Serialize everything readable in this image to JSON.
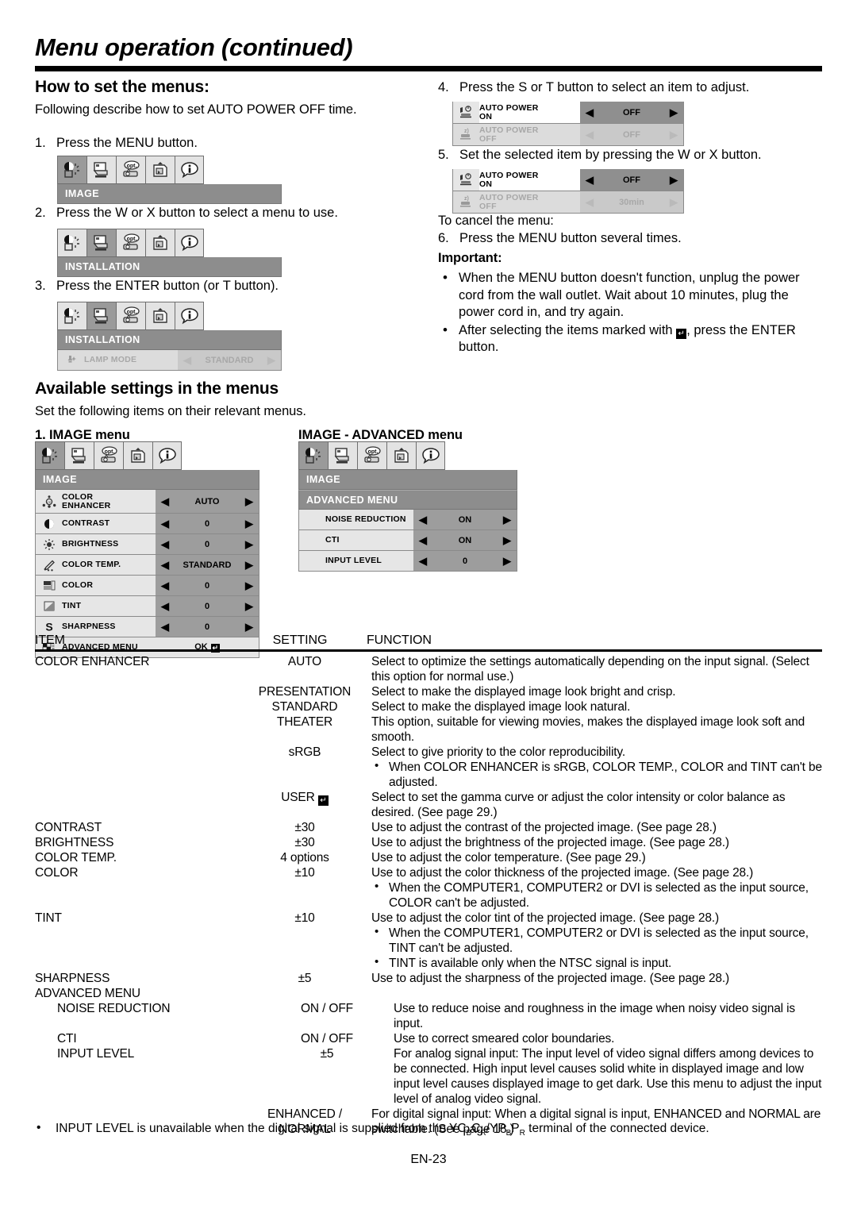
{
  "page": {
    "title": "Menu operation (continued)",
    "number": "EN-23"
  },
  "how_to": {
    "heading": "How to set the menus:",
    "intro": "Following describe how to set AUTO POWER OFF time.",
    "steps": [
      {
        "num": "1.",
        "text": "Press the MENU button."
      },
      {
        "num": "2.",
        "text": "Press the  W or  X button to select a menu to use."
      },
      {
        "num": "3.",
        "text": "Press the ENTER button (or  T button)."
      },
      {
        "num": "4.",
        "text": "Press the  S or  T button to select an item to adjust."
      },
      {
        "num": "5.",
        "text": "Set the selected item by pressing the  W or  X button."
      },
      {
        "num": "6.",
        "text": "Press the MENU button several times."
      }
    ],
    "cancel_label": "To cancel the menu:",
    "important_heading": "Important:",
    "important_items": [
      "When the MENU button doesn't function, unplug the power cord from the wall outlet. Wait about 10 minutes, plug the power cord in, and try again.",
      "After selecting the items marked with ↲, press the ENTER button."
    ]
  },
  "available": {
    "heading": "Available settings in the menus",
    "intro": "Set the following items on their relevant menus.",
    "image_menu_caption": "1. IMAGE menu",
    "advanced_menu_caption": "IMAGE - ADVANCED menu"
  },
  "osd": {
    "tabs": [
      "image-tab-icon",
      "installation-tab-icon",
      "option-tab-icon",
      "feature-tab-icon",
      "information-tab-icon"
    ],
    "step1": {
      "bar": "IMAGE",
      "selected_tab": 0
    },
    "step2": {
      "bar": "INSTALLATION",
      "selected_tab": 1
    },
    "step3": {
      "bar": "INSTALLATION",
      "selected_tab": 1,
      "rows": [
        {
          "label": "LAMP MODE",
          "value": "STANDARD",
          "state": "dim",
          "icon": "lamp-icon"
        }
      ]
    },
    "step4": {
      "rows": [
        {
          "label": "AUTO POWER ON",
          "value": "OFF",
          "state": "highlight",
          "icon": "auto-power-on-icon"
        },
        {
          "label": "AUTO POWER OFF",
          "value": "OFF",
          "state": "dim",
          "icon": "auto-power-off-icon"
        }
      ]
    },
    "step5": {
      "rows": [
        {
          "label": "AUTO POWER ON",
          "value": "OFF",
          "state": "highlight",
          "icon": "auto-power-on-icon"
        },
        {
          "label": "AUTO POWER OFF",
          "value": "30min",
          "state": "dim",
          "icon": "auto-power-off-icon"
        }
      ]
    },
    "image_menu": {
      "bar": "IMAGE",
      "selected_tab": 0,
      "rows": [
        {
          "label": "COLOR ENHANCER",
          "value": "AUTO",
          "icon": "color-enhancer-icon"
        },
        {
          "label": "CONTRAST",
          "value": "0",
          "icon": "contrast-icon"
        },
        {
          "label": "BRIGHTNESS",
          "value": "0",
          "icon": "brightness-icon"
        },
        {
          "label": "COLOR TEMP.",
          "value": "STANDARD",
          "icon": "color-temp-icon"
        },
        {
          "label": "COLOR",
          "value": "0",
          "icon": "color-icon"
        },
        {
          "label": "TINT",
          "value": "0",
          "icon": "tint-icon"
        },
        {
          "label": "SHARPNESS",
          "value": "0",
          "icon": "sharpness-icon"
        },
        {
          "label": "ADVANCED MENU",
          "value": "OK",
          "icon": "advanced-menu-icon",
          "type": "ok"
        }
      ]
    },
    "advanced_menu": {
      "bar": "IMAGE",
      "sub_bar": "ADVANCED MENU",
      "selected_tab": 0,
      "rows": [
        {
          "label": "NOISE REDUCTION",
          "value": "ON"
        },
        {
          "label": "CTI",
          "value": "ON"
        },
        {
          "label": "INPUT LEVEL",
          "value": "0"
        }
      ]
    }
  },
  "table": {
    "headers": {
      "item": "ITEM",
      "setting": "SETTING",
      "function": "FUNCTION"
    },
    "rows": [
      {
        "item": "COLOR ENHANCER",
        "setting": "AUTO",
        "function": "Select to optimize the settings automatically depending on the input signal. (Select this option for normal use.)"
      },
      {
        "item": "",
        "setting": "PRESENTATION",
        "function": "Select to make the displayed image look bright and crisp."
      },
      {
        "item": "",
        "setting": "STANDARD",
        "function": "Select to make the displayed image look natural."
      },
      {
        "item": "",
        "setting": "THEATER",
        "function": "This option, suitable for viewing movies, makes the displayed image look soft and smooth."
      },
      {
        "item": "",
        "setting": "sRGB",
        "function": "Select to give priority to the color reproducibility.",
        "bullets": [
          "When COLOR ENHANCER is sRGB, COLOR TEMP., COLOR and TINT can't be adjusted."
        ]
      },
      {
        "item": "",
        "setting": "USER ↲",
        "setting_mark": true,
        "function": "Select to set the gamma curve or adjust the color intensity or color balance as desired. (See page 29.)"
      },
      {
        "item": "CONTRAST",
        "setting": "±30",
        "function": "Use to adjust the contrast of the projected image. (See page 28.)"
      },
      {
        "item": "BRIGHTNESS",
        "setting": "±30",
        "function": "Use to adjust the brightness of the projected image. (See page 28.)"
      },
      {
        "item": "COLOR TEMP.",
        "setting": "4 options",
        "function": "Use to adjust the color temperature. (See page 29.)"
      },
      {
        "item": "COLOR",
        "setting": "±10",
        "function": "Use to adjust the color thickness of the projected image. (See page 28.)",
        "bullets": [
          "When the COMPUTER1, COMPUTER2 or DVI is selected as the input source, COLOR can't be adjusted."
        ]
      },
      {
        "item": "TINT",
        "setting": "±10",
        "function": "Use to adjust the color tint of the projected image. (See page 28.)",
        "bullets": [
          "When the COMPUTER1, COMPUTER2 or DVI is selected as the input source, TINT can't be adjusted.",
          "TINT is available only when the NTSC signal is input."
        ]
      },
      {
        "item": "SHARPNESS",
        "setting": "±5",
        "function": "Use to adjust the sharpness of the projected image. (See page 28.)"
      },
      {
        "item": "ADVANCED MENU",
        "setting": "",
        "function": ""
      },
      {
        "item": "NOISE REDUCTION",
        "indent": true,
        "setting": "ON / OFF",
        "function": "Use to reduce noise and roughness in the image when noisy video signal is input."
      },
      {
        "item": "CTI",
        "indent": true,
        "setting": "ON / OFF",
        "function": "Use to correct smeared color boundaries."
      },
      {
        "item": "INPUT LEVEL",
        "indent": true,
        "setting": "±5",
        "function": "For analog signal input: The input level of video signal differs among devices to be connected. High input level causes solid white in displayed image and low input level causes displayed image to get dark. Use this menu to adjust the input level of analog video signal."
      },
      {
        "item": "",
        "setting": "ENHANCED /\nNORMAL",
        "function": "For digital signal input: When a digital signal is input, ENHANCED and NORMAL are switchable. (See page 18.)"
      }
    ]
  },
  "footnote": {
    "text_before": "INPUT LEVEL is unavailable when the digital signal is supplied from the YC",
    "sub1": "B",
    "mid1": "C",
    "sub2": "R",
    "mid2": "/YP",
    "sub3": "B",
    "mid3": "P",
    "sub4": "R",
    "text_after": " terminal of the connected device."
  },
  "colors": {
    "bar": "#8d8d8d",
    "row": "#e6e6e6",
    "value": "#9d9d9d",
    "tab_selected": "#9a9a9a"
  }
}
